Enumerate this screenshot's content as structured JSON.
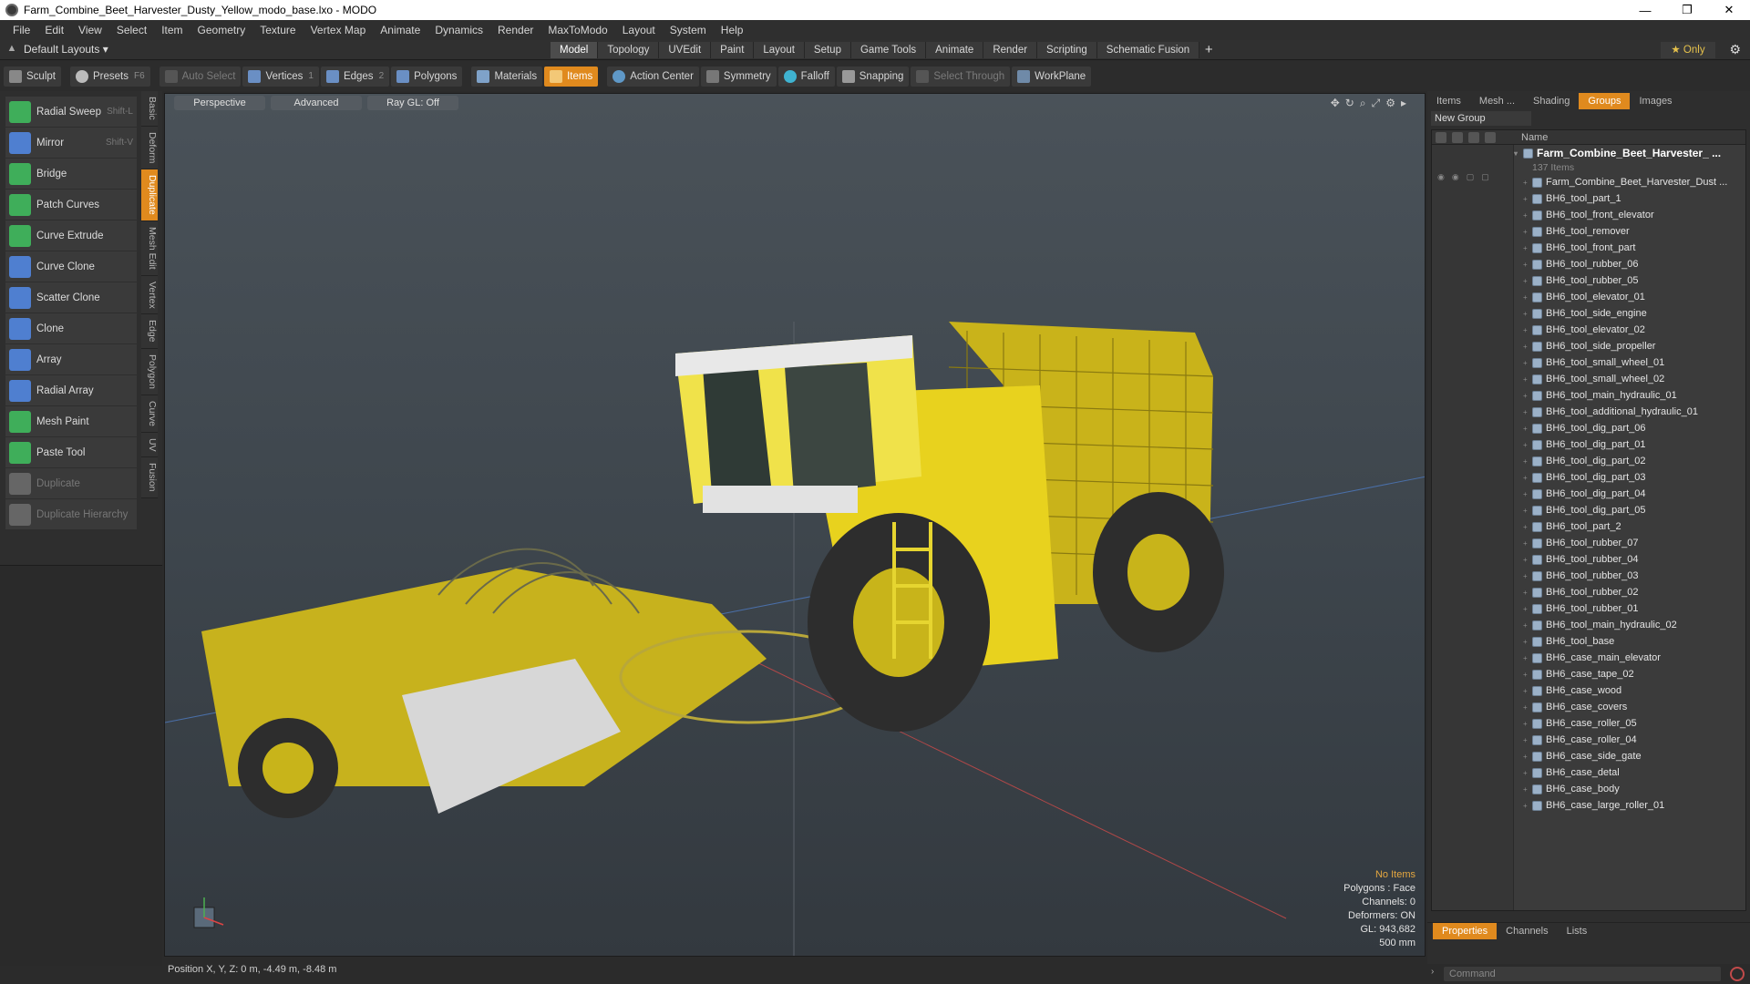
{
  "window": {
    "title": "Farm_Combine_Beet_Harvester_Dusty_Yellow_modo_base.lxo - MODO",
    "minimize": "—",
    "maximize": "❐",
    "close": "✕"
  },
  "menu": [
    "File",
    "Edit",
    "View",
    "Select",
    "Item",
    "Geometry",
    "Texture",
    "Vertex Map",
    "Animate",
    "Dynamics",
    "Render",
    "MaxToModo",
    "Layout",
    "System",
    "Help"
  ],
  "layout_bar": {
    "default_layouts": "Default Layouts ▾",
    "tabs": [
      "Model",
      "Topology",
      "UVEdit",
      "Paint",
      "Layout",
      "Setup",
      "Game Tools",
      "Animate",
      "Render",
      "Scripting",
      "Schematic Fusion"
    ],
    "active_tab": "Model",
    "add": "+",
    "only": "★  Only",
    "gear": "⚙"
  },
  "toolbar": {
    "sculpt": "Sculpt",
    "presets": "Presets",
    "presets_key": "F6",
    "auto_select": "Auto Select",
    "vertices": "Vertices",
    "vertices_count": "1",
    "edges": "Edges",
    "edges_count": "2",
    "polygons": "Polygons",
    "materials": "Materials",
    "items": "Items",
    "action_center": "Action Center",
    "symmetry": "Symmetry",
    "falloff": "Falloff",
    "snapping": "Snapping",
    "select_through": "Select Through",
    "workplane": "WorkPlane"
  },
  "tools": [
    {
      "label": "Radial Sweep",
      "hotkey": "Shift-L",
      "color": "#3fae5a",
      "disabled": false
    },
    {
      "label": "Mirror",
      "hotkey": "Shift-V",
      "color": "#4f7fd0",
      "disabled": false
    },
    {
      "label": "Bridge",
      "hotkey": "",
      "color": "#3fae5a",
      "disabled": false
    },
    {
      "label": "Patch Curves",
      "hotkey": "",
      "color": "#3fae5a",
      "disabled": false
    },
    {
      "label": "Curve Extrude",
      "hotkey": "",
      "color": "#3fae5a",
      "disabled": false
    },
    {
      "label": "Curve Clone",
      "hotkey": "",
      "color": "#4f7fd0",
      "disabled": false
    },
    {
      "label": "Scatter Clone",
      "hotkey": "",
      "color": "#4f7fd0",
      "disabled": false
    },
    {
      "label": "Clone",
      "hotkey": "",
      "color": "#4f7fd0",
      "disabled": false
    },
    {
      "label": "Array",
      "hotkey": "",
      "color": "#4f7fd0",
      "disabled": false
    },
    {
      "label": "Radial Array",
      "hotkey": "",
      "color": "#4f7fd0",
      "disabled": false
    },
    {
      "label": "Mesh Paint",
      "hotkey": "",
      "color": "#3fae5a",
      "disabled": false
    },
    {
      "label": "Paste Tool",
      "hotkey": "",
      "color": "#3fae5a",
      "disabled": false
    },
    {
      "label": "Duplicate",
      "hotkey": "",
      "color": "#666666",
      "disabled": true
    },
    {
      "label": "Duplicate Hierarchy",
      "hotkey": "",
      "color": "#666666",
      "disabled": true
    }
  ],
  "vertical_tabs": [
    "Basic",
    "Deform",
    "Duplicate",
    "Mesh Edit",
    "Vertex",
    "Edge",
    "Polygon",
    "Curve",
    "UV",
    "Fusion"
  ],
  "active_vertical_tab": "Duplicate",
  "viewport": {
    "perspective": "Perspective",
    "advanced": "Advanced",
    "ray_gl": "Ray GL: Off",
    "info_no_items": "No Items",
    "info_polygons": "Polygons : Face",
    "info_channels": "Channels: 0",
    "info_deformers": "Deformers: ON",
    "info_gl": "GL: 943,682",
    "info_scale": "500 mm"
  },
  "status": {
    "position": "Position X, Y, Z:   0 m, -4.49 m, -8.48 m"
  },
  "right_panel": {
    "tabs": [
      "Items",
      "Mesh ...",
      "Shading",
      "Groups",
      "Images"
    ],
    "active_tab": "Groups",
    "new_group": "New Group",
    "name_col": "Name",
    "group_name": "Farm_Combine_Beet_Harvester_ ...",
    "group_count": "137 Items",
    "items": [
      "Farm_Combine_Beet_Harvester_Dust ...",
      "BH6_tool_part_1",
      "BH6_tool_front_elevator",
      "BH6_tool_remover",
      "BH6_tool_front_part",
      "BH6_tool_rubber_06",
      "BH6_tool_rubber_05",
      "BH6_tool_elevator_01",
      "BH6_tool_side_engine",
      "BH6_tool_elevator_02",
      "BH6_tool_side_propeller",
      "BH6_tool_small_wheel_01",
      "BH6_tool_small_wheel_02",
      "BH6_tool_main_hydraulic_01",
      "BH6_tool_additional_hydraulic_01",
      "BH6_tool_dig_part_06",
      "BH6_tool_dig_part_01",
      "BH6_tool_dig_part_02",
      "BH6_tool_dig_part_03",
      "BH6_tool_dig_part_04",
      "BH6_tool_dig_part_05",
      "BH6_tool_part_2",
      "BH6_tool_rubber_07",
      "BH6_tool_rubber_04",
      "BH6_tool_rubber_03",
      "BH6_tool_rubber_02",
      "BH6_tool_rubber_01",
      "BH6_tool_main_hydraulic_02",
      "BH6_tool_base",
      "BH6_case_main_elevator",
      "BH6_case_tape_02",
      "BH6_case_wood",
      "BH6_case_covers",
      "BH6_case_roller_05",
      "BH6_case_roller_04",
      "BH6_case_side_gate",
      "BH6_case_detal",
      "BH6_case_body",
      "BH6_case_large_roller_01"
    ],
    "bottom_tabs": [
      "Properties",
      "Channels",
      "Lists"
    ],
    "active_bottom_tab": "Properties",
    "command_placeholder": "Command"
  }
}
